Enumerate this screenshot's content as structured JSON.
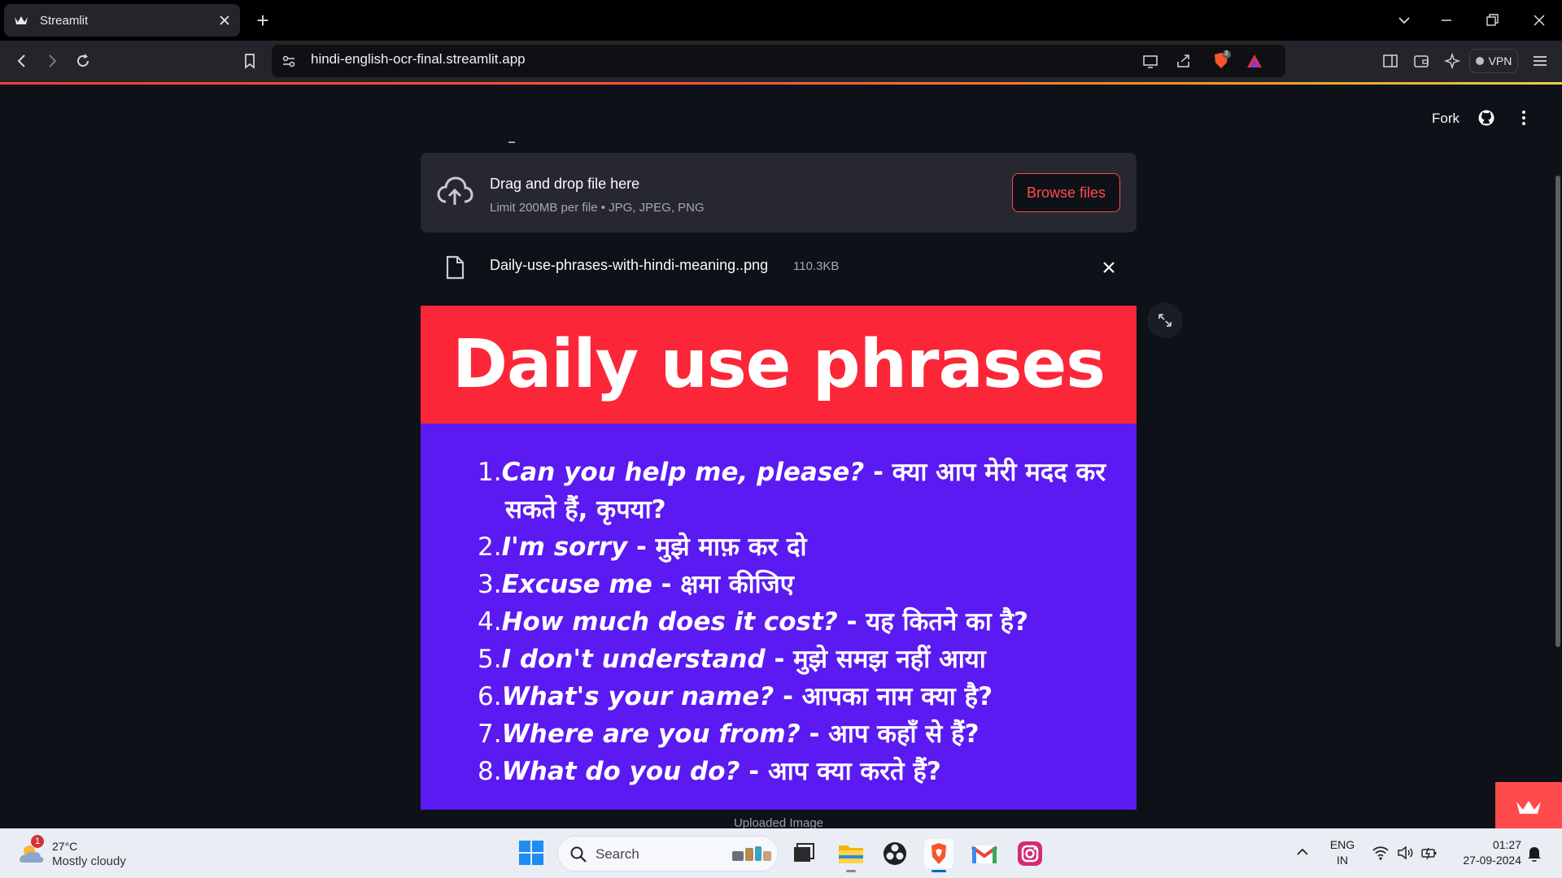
{
  "browser": {
    "tab_title": "Streamlit",
    "url": "hindi-english-ocr-final.streamlit.app",
    "shield_count": "3",
    "vpn_label": "VPN"
  },
  "app": {
    "fork_label": "Fork",
    "uploader": {
      "title": "Drag and drop file here",
      "limit": "Limit 200MB per file • JPG, JPEG, PNG",
      "browse_label": "Browse files"
    },
    "file": {
      "name": "Daily-use-phrases-with-hindi-meaning..png",
      "size": "110.3KB"
    },
    "image": {
      "heading": "Daily use phrases",
      "phrases": [
        {
          "num": "1.",
          "en": "Can you help me, please?",
          "hi": " - क्या आप मेरी मदद कर"
        },
        {
          "num": "",
          "en": "",
          "hi": "सकते हैं, कृपया?"
        },
        {
          "num": "2.",
          "en": "I'm sorry",
          "hi": " - मुझे माफ़ कर दो"
        },
        {
          "num": "3.",
          "en": "Excuse me",
          "hi": " - क्षमा कीजिए"
        },
        {
          "num": "4.",
          "en": "How much does it cost?",
          "hi": " - यह कितने का है?"
        },
        {
          "num": "5.",
          "en": "I don't understand",
          "hi": " - मुझे समझ नहीं आया"
        },
        {
          "num": "6.",
          "en": "What's your name?",
          "hi": " - आपका नाम क्या है?"
        },
        {
          "num": "7.",
          "en": "Where are you from?",
          "hi": " - आप कहाँ से हैं?"
        },
        {
          "num": "8.",
          "en": "What do you do?",
          "hi": " - आप क्या करते हैं?"
        }
      ]
    },
    "caption": "Uploaded Image"
  },
  "taskbar": {
    "weather_badge": "1",
    "temperature": "27°C",
    "weather": "Mostly cloudy",
    "search_placeholder": "Search",
    "lang_line1": "ENG",
    "lang_line2": "IN",
    "time": "01:27",
    "date": "27-09-2024"
  },
  "colors": {
    "streamlit_red": "#ff4b4b",
    "banner_red": "#fb2738",
    "banner_purple": "#5a1af1",
    "page_bg": "#0e1117"
  }
}
